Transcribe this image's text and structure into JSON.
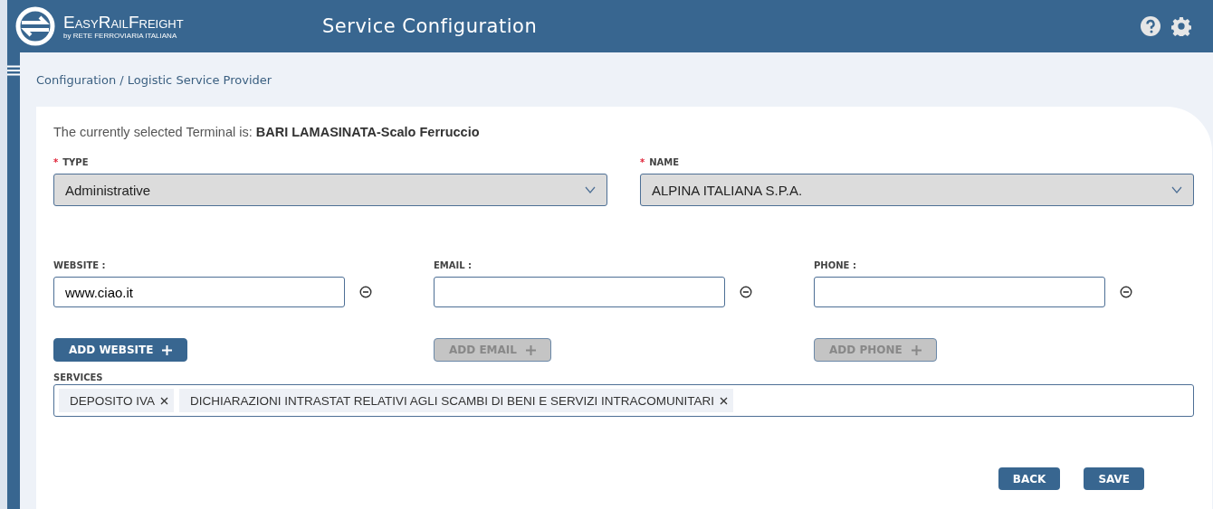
{
  "header": {
    "brand": "EasyRailFreight",
    "brand_sub": "by RETE FERROVIARIA ITALIANA",
    "title": "Service Configuration"
  },
  "breadcrumb": "Configuration / Logistic Service Provider",
  "terminal": {
    "label": "The currently selected Terminal is:",
    "value": "BARI LAMASINATA-Scalo Ferruccio"
  },
  "selects": [
    {
      "label": "TYPE",
      "required_mark": "*",
      "value": "Administrative"
    },
    {
      "label": "NAME",
      "required_mark": "*",
      "value": "ALPINA ITALIANA S.P.A."
    }
  ],
  "contacts": [
    {
      "label": "WEBSITE :",
      "value": "www.ciao.it",
      "add_button": "ADD WEBSITE",
      "add_disabled": false
    },
    {
      "label": "EMAIL :",
      "add_button": "ADD EMAIL",
      "add_disabled": true
    },
    {
      "label": "PHONE :",
      "add_button": "ADD PHONE",
      "add_disabled": true
    }
  ],
  "services": {
    "label": "SERVICES",
    "tags": [
      "DEPOSITO IVA",
      "DICHIARAZIONI INTRASTAT RELATIVI AGLI SCAMBI DI BENI E SERVIZI INTRACOMUNITARI"
    ]
  },
  "buttons": [
    "BACK",
    "SAVE"
  ]
}
